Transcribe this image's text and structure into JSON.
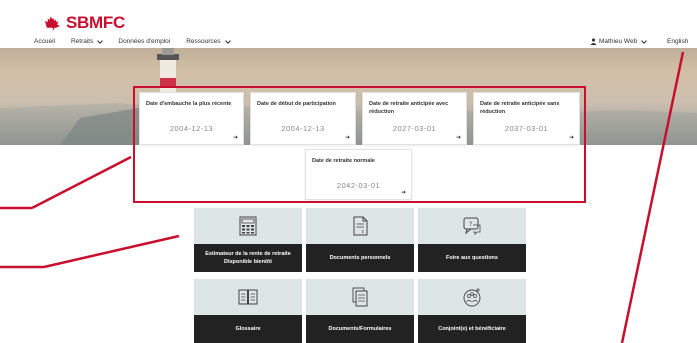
{
  "brand": {
    "name": "SBMFC",
    "color": "#c8102e"
  },
  "nav": {
    "items": [
      {
        "label": "Accueil"
      },
      {
        "label": "Retraits"
      },
      {
        "label": "Données d'emploi"
      },
      {
        "label": "Ressources"
      }
    ],
    "user": "Mathieu Web",
    "language": "English"
  },
  "dates": [
    {
      "label": "Date d'embauche la plus récente",
      "value": "2004-12-13"
    },
    {
      "label": "Date de début de participation",
      "value": "2004-12-13"
    },
    {
      "label": "Date de retraite anticipée avec réduction",
      "value": "2027-03-01"
    },
    {
      "label": "Date de retraite anticipée sans réduction",
      "value": "2037-03-01"
    },
    {
      "label": "Date de retraite normale",
      "value": "2042-03-01"
    }
  ],
  "tiles": [
    {
      "title": "Estimateur de la rente de retraite",
      "subtitle": "Disponible bientôt",
      "icon": "calculator-icon"
    },
    {
      "title": "Documents personnels",
      "subtitle": "",
      "icon": "document-icon"
    },
    {
      "title": "Foire aux questions",
      "subtitle": "",
      "icon": "question-bubble-icon"
    },
    {
      "title": "Glossaire",
      "subtitle": "",
      "icon": "book-icon"
    },
    {
      "title": "Documents/Formulaires",
      "subtitle": "",
      "icon": "forms-icon"
    },
    {
      "title": "Conjoint(e) et bénéficiaire",
      "subtitle": "",
      "icon": "people-icon"
    }
  ],
  "card_arrow": "➜",
  "annotation_color": "#c8102e"
}
